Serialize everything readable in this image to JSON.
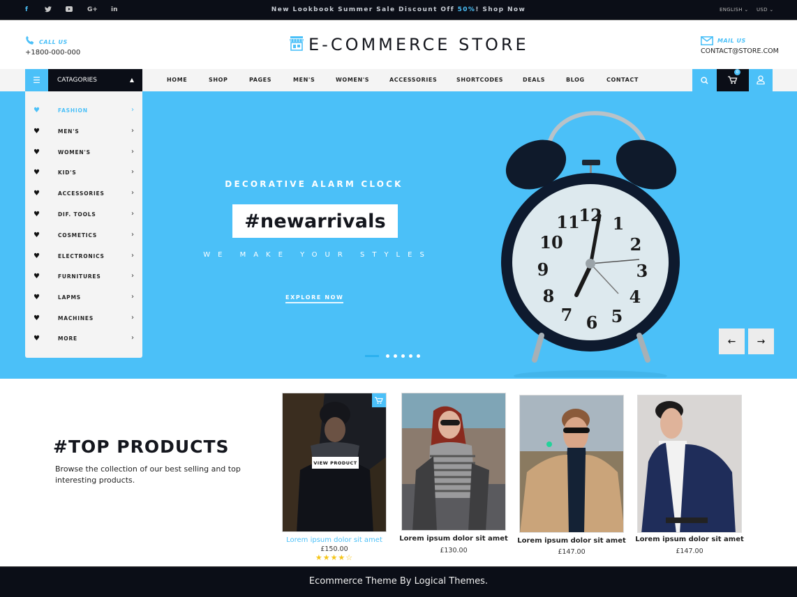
{
  "topbar": {
    "social": [
      {
        "name": "facebook-icon",
        "glyph": "f"
      },
      {
        "name": "twitter-icon",
        "glyph": "t"
      },
      {
        "name": "youtube-icon",
        "glyph": "▶"
      },
      {
        "name": "google-plus-icon",
        "glyph": "G+"
      },
      {
        "name": "linkedin-icon",
        "glyph": "in"
      }
    ],
    "promo_prefix": "New Lookbook Summer Sale Discount Off ",
    "promo_highlight": "50%",
    "promo_suffix": "! Shop Now",
    "language": "ENGLISH ⌄",
    "currency": "USD ⌄"
  },
  "header": {
    "call_label": "CALL US",
    "call_number": "+1800-000-000",
    "logo_text": "E-COMMERCE STORE",
    "mail_label": "MAIL US",
    "mail_value": "CONTACT@STORE.COM"
  },
  "nav": {
    "categories_label": "CATAGORIES",
    "items": [
      "HOME",
      "SHOP",
      "PAGES",
      "MEN'S",
      "WOMEN'S",
      "ACCESSORIES",
      "SHORTCODES",
      "DEALS",
      "BLOG",
      "CONTACT"
    ],
    "cart_count": "0"
  },
  "sidebar": {
    "items": [
      {
        "label": "FASHION",
        "active": true
      },
      {
        "label": " MEN'S"
      },
      {
        "label": "WOMEN'S"
      },
      {
        "label": "KID'S"
      },
      {
        "label": "ACCESSORIES"
      },
      {
        "label": "DIF. TOOLS"
      },
      {
        "label": "COSMETICS"
      },
      {
        "label": "ELECTRONICS"
      },
      {
        "label": "FURNITURES"
      },
      {
        "label": "LAPMS"
      },
      {
        "label": "MACHINES"
      },
      {
        "label": "MORE"
      }
    ]
  },
  "hero": {
    "subtitle": "DECORATIVE ALARM CLOCK",
    "title": "#newarrivals",
    "tagline": "WE MAKE YOUR STYLES",
    "cta": "EXPLORE NOW",
    "slide_count": 6,
    "active_slide": 1,
    "prev_label": "←",
    "next_label": "→",
    "bg_color": "#4bc0f8"
  },
  "top_products": {
    "title": "#TOP PRODUCTS",
    "description": "Browse the collection of our best selling and top interesting products.",
    "view_product_label": "VIEW PRODUCT",
    "products": [
      {
        "name": "Lorem ipsum dolor sit amet",
        "price": "£150.00",
        "rating": 4,
        "rating_max": 5,
        "stars": "★★★★☆"
      },
      {
        "name": "Lorem ipsum dolor sit amet",
        "price": "£130.00"
      },
      {
        "name": "Lorem ipsum dolor sit amet",
        "price": "£147.00"
      },
      {
        "name": "Lorem ipsum dolor sit amet",
        "price": "£147.00"
      }
    ]
  },
  "footer": {
    "text": "Ecommerce Theme By Logical Themes."
  },
  "colors": {
    "accent": "#4bc0f8",
    "dark": "#0b0e17",
    "nav_bg": "#f4f4f4"
  }
}
